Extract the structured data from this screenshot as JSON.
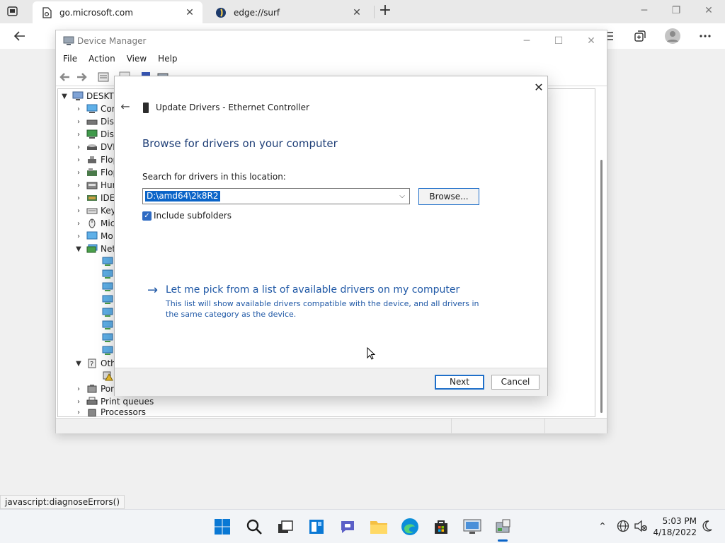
{
  "browser": {
    "tabs": [
      {
        "title": "go.microsoft.com",
        "active": true
      },
      {
        "title": "edge://surf",
        "active": false
      }
    ],
    "status_url": "javascript:diagnoseErrors()"
  },
  "device_manager": {
    "title": "Device Manager",
    "menu": [
      "File",
      "Action",
      "View",
      "Help"
    ],
    "tree": [
      {
        "label": "DESKTO",
        "expanded": true
      },
      {
        "label": "Cor"
      },
      {
        "label": "Disk"
      },
      {
        "label": "Disp"
      },
      {
        "label": "DVD"
      },
      {
        "label": "Flop"
      },
      {
        "label": "Flop"
      },
      {
        "label": "Hun"
      },
      {
        "label": "IDE"
      },
      {
        "label": "Key"
      },
      {
        "label": "Mic"
      },
      {
        "label": "Mo"
      },
      {
        "label": "Net",
        "expanded": true
      },
      {
        "label": "Oth",
        "expanded": true
      },
      {
        "label": "Por"
      },
      {
        "label": "Print queues"
      },
      {
        "label": "Processors"
      }
    ]
  },
  "dialog": {
    "header": "Update Drivers - Ethernet Controller",
    "heading": "Browse for drivers on your computer",
    "search_label": "Search for drivers in this location:",
    "path_value": "D:\\amd64\\2k8R2",
    "browse_label": "Browse...",
    "include_subfolders_label": "Include subfolders",
    "include_subfolders_checked": true,
    "pick_link": "Let me pick from a list of available drivers on my computer",
    "pick_desc": "This list will show available drivers compatible with the device, and all drivers in the same category as the device.",
    "next_label": "Next",
    "cancel_label": "Cancel"
  },
  "taskbar": {
    "time": "5:03 PM",
    "date": "4/18/2022"
  },
  "colors": {
    "accent": "#0a64c8",
    "link": "#1f58a6",
    "heading": "#1f3f77"
  }
}
